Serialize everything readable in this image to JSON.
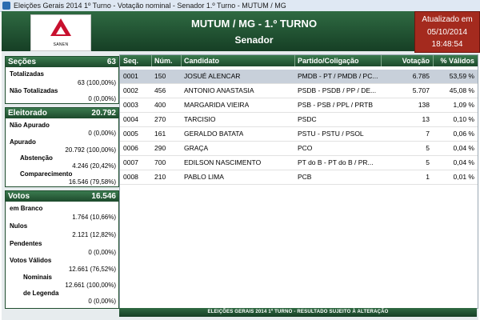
{
  "window": {
    "title": "Eleições Gerais 2014 1º Turno - Votação nominal - Senador 1.º Turno - MUTUM / MG"
  },
  "header": {
    "logo_text": "SANEN",
    "city": "MUTUM / MG - 1.º TURNO",
    "role": "Senador",
    "updated_label": "Atualizado em",
    "updated_date": "05/10/2014",
    "updated_time": "18:48:54"
  },
  "secoes": {
    "label": "Seções",
    "value": "63",
    "totalizadas_label": "Totalizadas",
    "totalizadas_value": "63 (100,00%)",
    "nao_totalizadas_label": "Não Totalizadas",
    "nao_totalizadas_value": "0 (0,00%)"
  },
  "eleitorado": {
    "label": "Eleitorado",
    "value": "20.792",
    "nao_apurado_label": "Não Apurado",
    "nao_apurado_value": "0 (0,00%)",
    "apurado_label": "Apurado",
    "apurado_value": "20.792 (100,00%)",
    "abstencao_label": "Abstenção",
    "abstencao_value": "4.246 (20,42%)",
    "comparecimento_label": "Comparecimento",
    "comparecimento_value": "16.546 (79,58%)"
  },
  "votos": {
    "label": "Votos",
    "value": "16.546",
    "branco_label": "em Branco",
    "branco_value": "1.764 (10,66%)",
    "nulos_label": "Nulos",
    "nulos_value": "2.121 (12,82%)",
    "pendentes_label": "Pendentes",
    "pendentes_value": "0 (0,00%)",
    "validos_label": "Votos Válidos",
    "validos_value": "12.661 (76,52%)",
    "nominais_label": "Nominais",
    "nominais_value": "12.661 (100,00%)",
    "legenda_label": "de Legenda",
    "legenda_value": "0 (0,00%)"
  },
  "table": {
    "headers": [
      "Seq.",
      "Núm.",
      "Candidato",
      "Partido/Coligação",
      "Votação",
      "% Válidos"
    ],
    "rows": [
      [
        "0001",
        "150",
        "JOSUÉ ALENCAR",
        "PMDB - PT / PMDB / PC...",
        "6.785",
        "53,59 %"
      ],
      [
        "0002",
        "456",
        "ANTONIO ANASTASIA",
        "PSDB - PSDB / PP / DE...",
        "5.707",
        "45,08 %"
      ],
      [
        "0003",
        "400",
        "MARGARIDA VIEIRA",
        "PSB - PSB / PPL / PRTB",
        "138",
        "1,09 %"
      ],
      [
        "0004",
        "270",
        "TARCISIO",
        "PSDC",
        "13",
        "0,10 %"
      ],
      [
        "0005",
        "161",
        "GERALDO BATATA",
        "PSTU - PSTU / PSOL",
        "7",
        "0,06 %"
      ],
      [
        "0006",
        "290",
        "GRAÇA",
        "PCO",
        "5",
        "0,04 %"
      ],
      [
        "0007",
        "700",
        "EDILSON NASCIMENTO",
        "PT do B - PT do B / PR...",
        "5",
        "0,04 %"
      ],
      [
        "0008",
        "210",
        "PABLO LIMA",
        "PCB",
        "1",
        "0,01 %"
      ]
    ]
  },
  "footer": {
    "text": "ELEIÇÕES GERAIS 2014 1º TURNO - RESULTADO SUJEITO À ALTERAÇÃO"
  }
}
